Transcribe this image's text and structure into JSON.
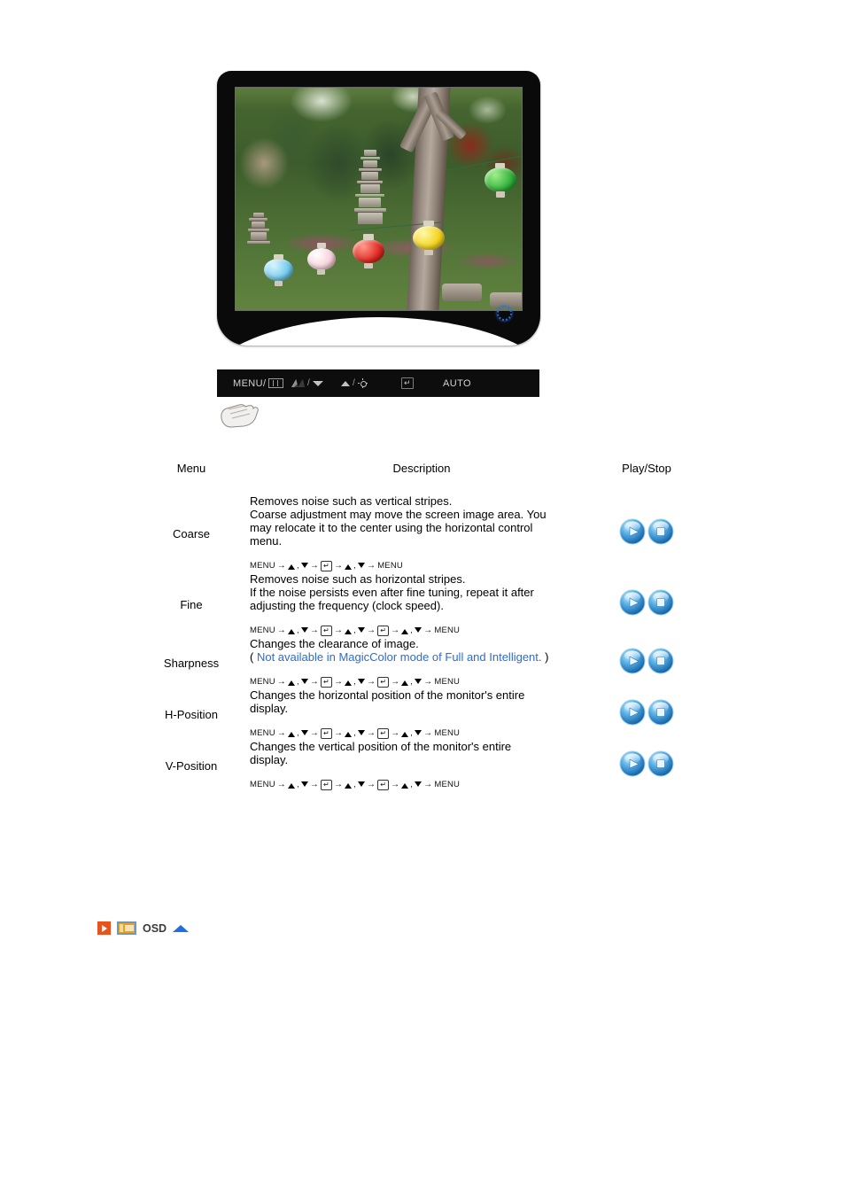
{
  "monitor": {
    "power_led_name": "power-indicator-led",
    "screen_scene": "garden-photo-with-pagoda-and-lanterns"
  },
  "control_bar": {
    "menu_label": "MENU/",
    "magicbright_sep": "/",
    "brightness_sep": "/",
    "enter_label": "↵",
    "auto_label": "AUTO"
  },
  "table": {
    "headers": {
      "menu": "Menu",
      "description": "Description",
      "play_stop": "Play/Stop"
    },
    "rows": [
      {
        "menu": "Coarse",
        "description_lines": [
          "Removes noise such as vertical stripes.",
          "Coarse adjustment may move the screen image area. You",
          "may relocate it to the center using the horizontal control",
          "menu."
        ],
        "hint": "",
        "sequence": "MENU → ▲ , ▼ → ↵ → ↵ → ▲ , ▼ → MENU",
        "sequence_type": "short"
      },
      {
        "menu": "Fine",
        "description_lines": [
          "Removes noise such as horizontal stripes.",
          "If the noise persists even after fine tuning, repeat it after",
          "adjusting the frequency (clock speed)."
        ],
        "hint": "",
        "sequence": "MENU → ▲ , ▼ → ↵ → ▲ , ▼ → ↵ → ▲ , ▼ → MENU",
        "sequence_type": "long"
      },
      {
        "menu": "Sharpness",
        "description_lines": [
          "Changes the clearance of image."
        ],
        "hint_open_paren": "( ",
        "hint": "Not available in MagicColor mode of Full and Intelligent.",
        "hint_close_paren": " )",
        "sequence": "MENU → ▲ , ▼ → ↵ → ▲ , ▼ → ↵ → ▲ , ▼ → MENU",
        "sequence_type": "long"
      },
      {
        "menu": "H-Position",
        "description_lines": [
          "Changes the horizontal position of the monitor's entire",
          "display."
        ],
        "hint": "",
        "sequence": "MENU → ▲ , ▼ → ↵ → ▲ , ▼ → ↵ → ▲ , ▼ → MENU",
        "sequence_type": "long"
      },
      {
        "menu": "V-Position",
        "description_lines": [
          "Changes the vertical position of the monitor's entire",
          "display."
        ],
        "hint": "",
        "sequence": "MENU → ▲ , ▼ → ↵ → ▲ , ▼ → ↵ → ▲ , ▼ → MENU",
        "sequence_type": "long"
      }
    ]
  },
  "footer": {
    "label": "OSD"
  },
  "colors": {
    "hint_blue": "#2b6cd4",
    "orange_icon": "#e8521e",
    "osd_icon_amber": "#e8a020",
    "osd_icon_border": "#6d97c4",
    "top_arrow_blue": "#1f6fe0",
    "button_blue": "#3f9ce0",
    "bezel_black": "#0a0a0a"
  }
}
